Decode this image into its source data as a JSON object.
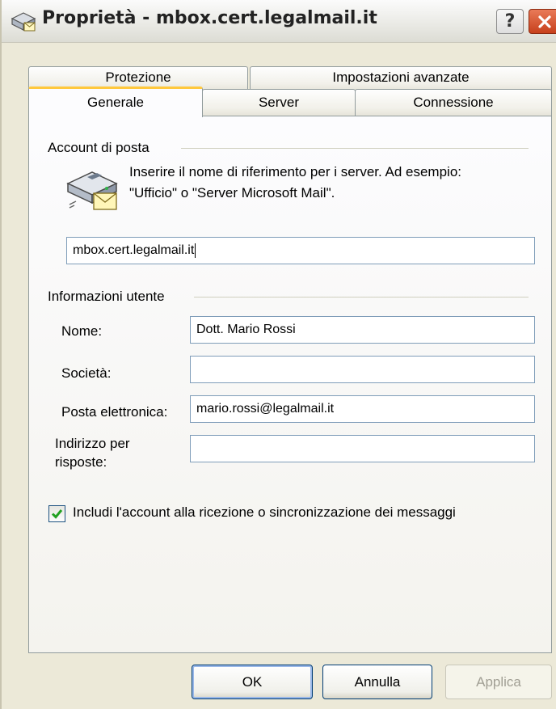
{
  "window": {
    "title": "Proprietà - mbox.cert.legalmail.it"
  },
  "titlebar_buttons": {
    "help_label": "?",
    "close_label": "X"
  },
  "tabs": {
    "row1": [
      "Protezione",
      "Impostazioni avanzate"
    ],
    "row2": [
      "Generale",
      "Server",
      "Connessione"
    ],
    "active": "Generale"
  },
  "account_section": {
    "label": "Account di posta",
    "description_line1": "Inserire il nome di riferimento per i server. Ad esempio:",
    "description_line2": "\"Ufficio\" o \"Server Microsoft Mail\".",
    "account_name_value": "mbox.cert.legalmail.it",
    "icon": "mail-account-icon"
  },
  "user_section": {
    "label": "Informazioni utente",
    "name_label": "Nome:",
    "name_value": "Dott. Mario Rossi",
    "company_label": "Società:",
    "company_value": "",
    "email_label": "Posta elettronica:",
    "email_value": "mario.rossi@legalmail.it",
    "reply_label_line1": "Indirizzo per",
    "reply_label_line2": "risposte:",
    "reply_value": ""
  },
  "options": {
    "include_account_label": "Includi l'account alla ricezione o sincronizzazione dei messaggi",
    "include_account_checked": true
  },
  "buttons": {
    "ok": "OK",
    "cancel": "Annulla",
    "apply": "Applica"
  },
  "colors": {
    "active_tab_accent": "#ffc83c",
    "input_border": "#7f9db9",
    "close_button": "#c7401c"
  }
}
